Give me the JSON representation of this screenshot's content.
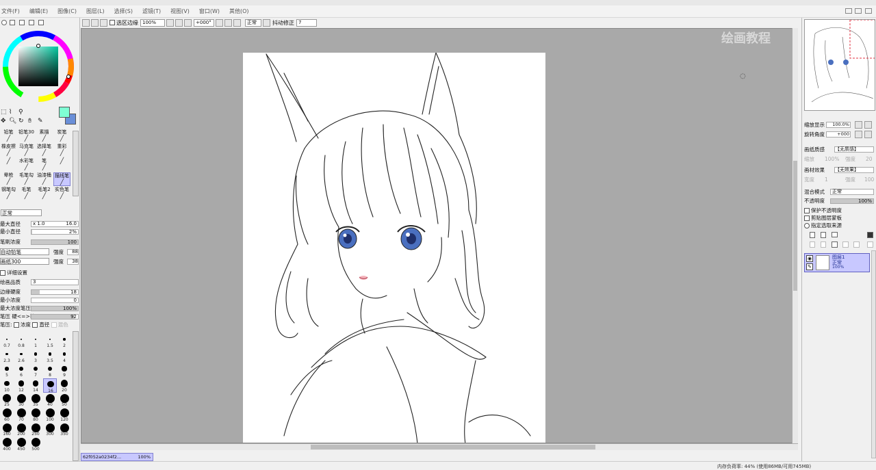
{
  "menu": {
    "items": [
      "文件(F)",
      "编辑(E)",
      "图像(C)",
      "图层(L)",
      "选择(S)",
      "滤镜(T)",
      "视图(V)",
      "窗口(W)",
      "其他(O)"
    ]
  },
  "toolbar": {
    "selection_edge_label": "选区边缘",
    "zoom_value": "100%",
    "rotation_value": "+000°",
    "blend_mode": "正常",
    "stabilizer_label": "抖动修正",
    "stabilizer_value": "7"
  },
  "canvas": {
    "watermark": "绘画教程"
  },
  "tools": {
    "brushes": [
      [
        "铅笔",
        "铅笔30",
        "素描",
        "炭笔"
      ],
      [
        "橡皮擦",
        "马克笔",
        "选择笔",
        "重彩"
      ],
      [
        "",
        "水彩笔",
        "笔",
        ""
      ],
      [
        "晕枪",
        "毛笔勾",
        "油漆桶",
        "描线笔"
      ],
      [
        "钢笔勾",
        "毛笔",
        "毛笔2",
        "实色笔"
      ]
    ],
    "blend_mode": "正常",
    "max_size_label": "最大直径",
    "max_size_mult": "x 1.0",
    "max_size_value": "16.0",
    "min_size_label": "最小直径",
    "min_size_value": "2%",
    "density_label": "笔刷浓度",
    "density_value": "100",
    "shape1": "自动铅笔",
    "shape1_strength_label": "强度",
    "shape1_strength": "88",
    "texture": "画纸300",
    "texture_strength_label": "强度",
    "texture_strength": "38",
    "detail_label": "详细设置",
    "quality_label": "绘画品质",
    "quality_value": "3",
    "edge_hardness_label": "边缘硬度",
    "edge_hardness_value": "18",
    "min_density_label": "最小浓度",
    "min_density_value": "0",
    "max_density_pressure_label": "最大浓度笔压",
    "max_density_pressure_value": "100%",
    "pressure_hardness_label": "笔压 硬<=>软",
    "pressure_hardness_value": "92",
    "pressure_label": "笔压:",
    "pressure_density": "浓度",
    "pressure_size": "直径",
    "pressure_blend": "混色",
    "brush_sizes": [
      "0.7",
      "0.8",
      "1",
      "1.5",
      "2",
      "2.3",
      "2.6",
      "3",
      "3.5",
      "4",
      "5",
      "6",
      "7",
      "8",
      "9",
      "10",
      "12",
      "14",
      "16",
      "20",
      "25",
      "30",
      "35",
      "40",
      "50",
      "60",
      "70",
      "80",
      "100",
      "120",
      "160",
      "200",
      "250",
      "300",
      "350",
      "400",
      "450",
      "500"
    ],
    "selected_size": "16"
  },
  "navigator": {
    "zoom_label": "缩放显示",
    "zoom_value": "100.0%",
    "rotate_label": "旋转角度",
    "rotate_value": "+000"
  },
  "layer_panel": {
    "paper_texture_label": "画纸质感",
    "paper_texture_value": "【无质感】",
    "scale_label": "缩放",
    "scale_value": "100%",
    "strength_label": "强度",
    "strength_value": "20",
    "paper_effect_label": "画材效果",
    "paper_effect_value": "【无效果】",
    "width_label": "宽度",
    "width_value": "1",
    "effect_strength_label": "强度",
    "effect_strength_value": "100",
    "blend_mode_label": "混合模式",
    "blend_mode_value": "正常",
    "opacity_label": "不透明度",
    "opacity_value": "100%",
    "protect_opacity": "保护不透明度",
    "clip_group": "剪贴图层蒙板",
    "selection_source": "指定选取来源",
    "layer_name": "图层1",
    "layer_mode": "正常",
    "layer_opacity": "100%"
  },
  "status": {
    "doc_tab": "62f052a0234f2...",
    "doc_zoom": "100%",
    "memory": "内存负荷率: 44% (使用86MB/可用745MB)"
  },
  "colors": {
    "foreground": "#7fffd4",
    "background": "#6a8fd8",
    "canvas_bg": "#a9a9a9",
    "selection_blue": "#c8c8ff"
  }
}
